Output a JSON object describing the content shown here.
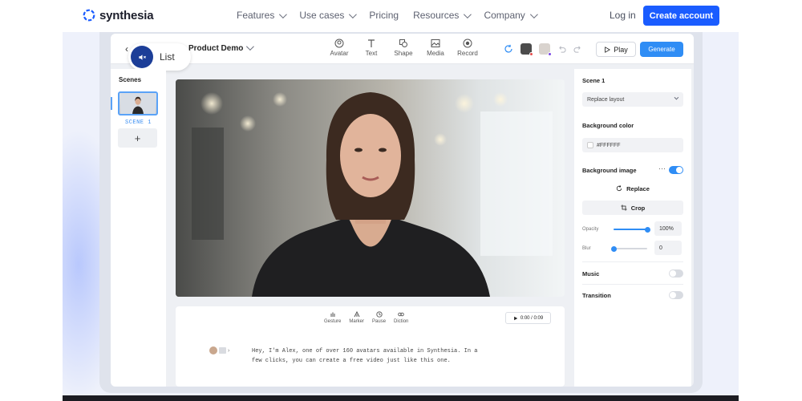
{
  "brand": {
    "name": "synthesia",
    "accent": "#1a5cff"
  },
  "nav": {
    "links": [
      {
        "label": "Features",
        "dropdown": true
      },
      {
        "label": "Use cases",
        "dropdown": true
      },
      {
        "label": "Pricing",
        "dropdown": false
      },
      {
        "label": "Resources",
        "dropdown": true
      },
      {
        "label": "Company",
        "dropdown": true
      }
    ],
    "login": "Log in",
    "create_account": "Create account"
  },
  "mute": {
    "label": "List",
    "icon": "speaker-muted-icon"
  },
  "editor": {
    "project_title": "Product Demo",
    "tools": [
      {
        "label": "Avatar",
        "icon": "avatar-icon"
      },
      {
        "label": "Text",
        "icon": "text-icon"
      },
      {
        "label": "Shape",
        "icon": "shape-icon"
      },
      {
        "label": "Media",
        "icon": "media-icon"
      },
      {
        "label": "Record",
        "icon": "record-icon"
      }
    ],
    "play_label": "Play",
    "generate_label": "Generate"
  },
  "scenes": {
    "title": "Scenes",
    "items": [
      {
        "label": "SCENE 1"
      }
    ],
    "add_label": "+"
  },
  "script": {
    "tools": [
      {
        "label": "Gesture",
        "icon": "gesture-icon"
      },
      {
        "label": "Marker",
        "icon": "marker-icon"
      },
      {
        "label": "Pause",
        "icon": "pause-clock-icon"
      },
      {
        "label": "Diction",
        "icon": "diction-icon"
      }
    ],
    "timer": "0:00 / 0:09",
    "text": "Hey, I'm Alex, one of over 160 avatars available in Synthesia. In a few clicks, you can create a free video just like this one."
  },
  "panel": {
    "scene_title": "Scene 1",
    "layout_select": "Replace layout",
    "background_color_label": "Background color",
    "background_color_value": "#FFFFFF",
    "background_image_label": "Background image",
    "background_image_enabled": true,
    "replace_label": "Replace",
    "crop_label": "Crop",
    "opacity_label": "Opacity",
    "opacity_value": "100%",
    "opacity_fraction": 1.0,
    "blur_label": "Blur",
    "blur_value": "0",
    "blur_fraction": 0,
    "music_label": "Music",
    "music_enabled": false,
    "transition_label": "Transition",
    "transition_enabled": false
  }
}
